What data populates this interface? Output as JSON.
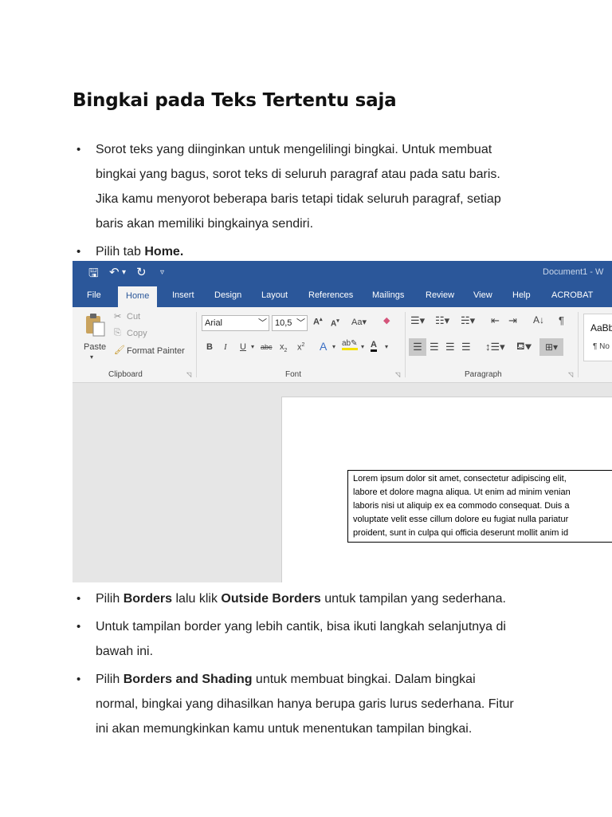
{
  "heading": "Bingkai pada Teks Tertentu saja",
  "bullets_top": [
    {
      "lines": [
        "Sorot teks yang  diinginkan untuk mengelilingi bingkai. Untuk membuat",
        "bingkai yang bagus, sorot teks di seluruh paragraf atau pada satu baris.",
        "Jika kamu menyorot beberapa baris tetapi tidak seluruh paragraf, setiap",
        "baris akan memiliki bingkainya sendiri."
      ]
    },
    {
      "pre": "Pilih tab ",
      "bold": "Home."
    }
  ],
  "word": {
    "doc_title": "Document1 - W",
    "tabs": [
      "File",
      "Home",
      "Insert",
      "Design",
      "Layout",
      "References",
      "Mailings",
      "Review",
      "View",
      "Help",
      "ACROBAT"
    ],
    "active_tab": "Home",
    "clipboard": {
      "paste": "Paste",
      "cut": "Cut",
      "copy": "Copy",
      "format_painter": "Format Painter",
      "label": "Clipboard"
    },
    "font": {
      "name": "Arial",
      "size": "10,5",
      "label": "Font"
    },
    "paragraph": {
      "label": "Paragraph"
    },
    "styles": {
      "sample": "AaBb",
      "normal": "¶ No"
    },
    "doc_lines": [
      "Lorem ipsum dolor sit amet, consectetur adipiscing elit,",
      "labore et dolore magna aliqua. Ut enim ad minim venian",
      "laboris nisi ut aliquip ex ea commodo consequat. Duis a",
      "voluptate velit esse cillum dolore eu fugiat nulla pariatur",
      "proident, sunt in culpa qui officia deserunt mollit anim id"
    ]
  },
  "bullets_bottom": [
    {
      "pre": "Pilih ",
      "b1": "Borders",
      "mid": " lalu klik ",
      "b2": "Outside Borders",
      "post": " untuk tampilan yang sederhana."
    },
    {
      "lines": [
        "Untuk tampilan border yang lebih cantik, bisa ikuti langkah selanjutnya di",
        "bawah ini."
      ]
    },
    {
      "pre": "Pilih ",
      "b1": "Borders and Shading",
      "post": " untuk membuat bingkai. Dalam bingkai",
      "lines": [
        "normal, bingkai yang dihasilkan hanya berupa garis lurus sederhana. Fitur",
        "ini akan memungkinkan kamu untuk menentukan tampilan bingkai."
      ]
    }
  ]
}
